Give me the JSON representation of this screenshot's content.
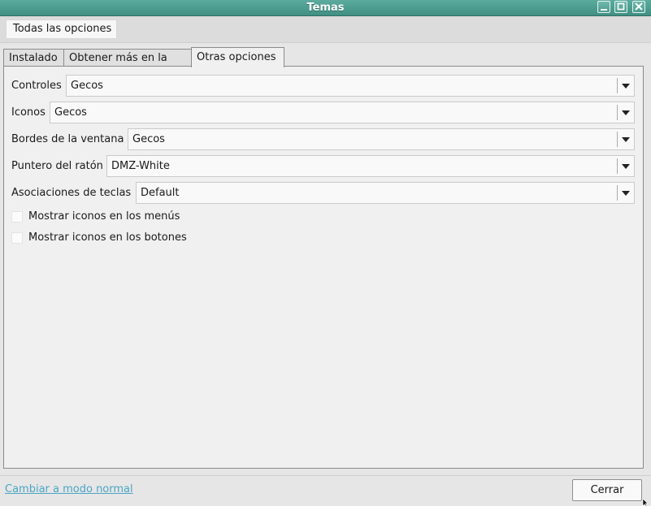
{
  "window": {
    "title": "Temas"
  },
  "toolbar": {
    "all_options_label": "Todas las opciones"
  },
  "tabs": [
    {
      "label": "Instalado",
      "active": false
    },
    {
      "label": "Obtener más en la red",
      "active": false
    },
    {
      "label": "Otras opciones",
      "active": true
    }
  ],
  "settings": [
    {
      "label": "Controles",
      "value": "Gecos"
    },
    {
      "label": "Iconos",
      "value": "Gecos"
    },
    {
      "label": "Bordes de la ventana",
      "value": "Gecos"
    },
    {
      "label": "Puntero del ratón",
      "value": "DMZ-White"
    },
    {
      "label": "Asociaciones de teclas",
      "value": "Default"
    }
  ],
  "checkboxes": [
    {
      "label": "Mostrar iconos en los menús",
      "checked": false
    },
    {
      "label": "Mostrar iconos en los botones",
      "checked": false
    }
  ],
  "footer": {
    "mode_link": "Cambiar a modo normal",
    "close_label": "Cerrar"
  },
  "colors": {
    "titlebar": "#4c9b8f",
    "link": "#4aa6c4"
  },
  "icons": [
    "minimize-icon",
    "maximize-icon",
    "close-icon",
    "dropdown-arrow-icon",
    "mouse-pointer-icon"
  ]
}
